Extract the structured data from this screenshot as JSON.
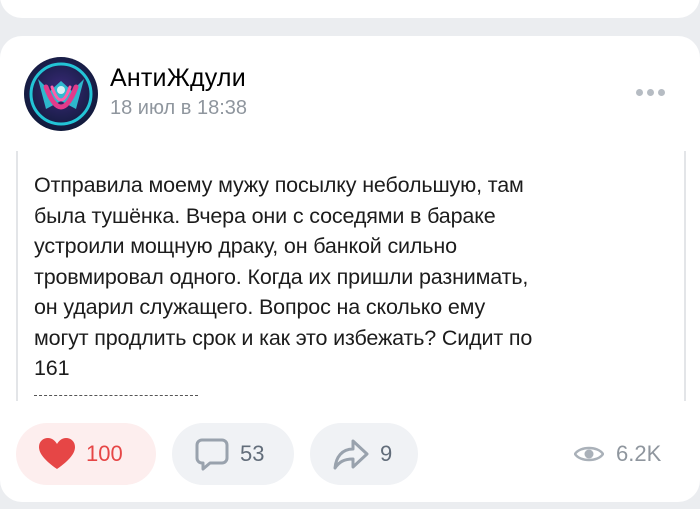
{
  "post": {
    "author": "АнтиЖдули",
    "date": "18 июл в 18:38",
    "text": "Отправила моему мужу посылку небольшую, там\nбыла тушёнка. Вчера они с соседями в бараке\nустроили мощную драку, он банкой сильно\nтровмировал одного. Когда их пришли разнимать,\nон ударил служащего. Вопрос на сколько ему\nмогут продлить срок и как это избежать? Сидит по\n161"
  },
  "actions": {
    "likes": "100",
    "comments": "53",
    "shares": "9",
    "views": "6.2K"
  },
  "icons": {
    "like": "heart-icon",
    "comment": "comment-bubble-icon",
    "share": "share-arrow-icon",
    "views": "eye-icon",
    "more": "more-dots-icon"
  },
  "colors": {
    "like_accent": "#e64646",
    "like_bg": "#fdeeee",
    "muted": "#8f969e",
    "page_bg": "#ebedf0"
  }
}
